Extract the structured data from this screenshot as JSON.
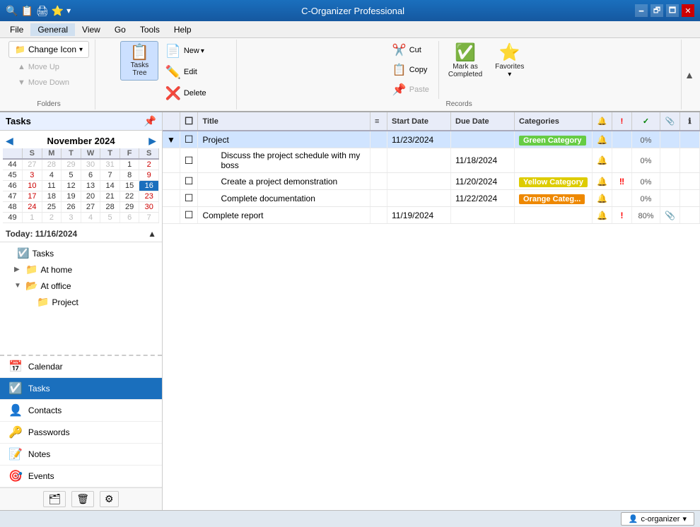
{
  "titlebar": {
    "title": "C-Organizer Professional",
    "controls": [
      "minimize",
      "restore",
      "maximize",
      "close"
    ]
  },
  "menu": {
    "items": [
      "File",
      "General",
      "View",
      "Go",
      "Tools",
      "Help"
    ],
    "active": "General"
  },
  "ribbon": {
    "folders_group": {
      "label": "Folders",
      "change_icon": "Change Icon",
      "move_up": "Move Up",
      "move_down": "Move Down",
      "change_icon_symbol": "📁"
    },
    "nav_group": {
      "tasks_tree_label": "Tasks\nTree",
      "new_label": "New",
      "edit_label": "Edit",
      "delete_label": "Delete",
      "tasks_tree_icon": "📋",
      "new_icon": "📄",
      "edit_icon": "✏️",
      "delete_icon": "❌"
    },
    "records_group": {
      "label": "Records",
      "cut_label": "Cut",
      "copy_label": "Copy",
      "paste_label": "Paste",
      "mark_completed_label": "Mark as\nCompleted",
      "favorites_label": "Favorites",
      "cut_icon": "✂️",
      "copy_icon": "📋",
      "paste_icon": "📌",
      "mark_icon": "✅",
      "favorites_icon": "⭐"
    }
  },
  "left_panel": {
    "tasks_header": "Tasks",
    "calendar": {
      "month": "November",
      "year": "2024",
      "month_year": "November 2024",
      "days_of_week": [
        "S",
        "M",
        "T",
        "W",
        "T",
        "F",
        "S"
      ],
      "week_nums": [
        "44",
        "45",
        "46",
        "47",
        "48",
        "49"
      ],
      "weeks": [
        [
          "27",
          "28",
          "29",
          "30",
          "31",
          "1",
          "2"
        ],
        [
          "3",
          "4",
          "5",
          "6",
          "7",
          "8",
          "9"
        ],
        [
          "10",
          "11",
          "12",
          "13",
          "14",
          "15",
          "16"
        ],
        [
          "17",
          "18",
          "19",
          "20",
          "21",
          "22",
          "23"
        ],
        [
          "24",
          "25",
          "26",
          "27",
          "28",
          "29",
          "30"
        ],
        [
          "1",
          "2",
          "3",
          "4",
          "5",
          "6",
          "7"
        ]
      ],
      "today_col": 6,
      "today_row": 2,
      "today_date": 16
    },
    "today_label": "Today: 11/16/2024",
    "tree": [
      {
        "label": "Tasks",
        "icon": "📋",
        "indent": 0,
        "has_expander": false,
        "expander": ""
      },
      {
        "label": "At home",
        "icon": "📁",
        "indent": 1,
        "has_expander": true,
        "expander": "▶"
      },
      {
        "label": "At office",
        "icon": "📂",
        "indent": 1,
        "has_expander": true,
        "expander": "▼"
      },
      {
        "label": "Project",
        "icon": "📁",
        "indent": 2,
        "has_expander": false,
        "expander": ""
      }
    ],
    "nav_items": [
      {
        "label": "Calendar",
        "icon": "📅",
        "id": "calendar"
      },
      {
        "label": "Tasks",
        "icon": "☑️",
        "id": "tasks",
        "active": true
      },
      {
        "label": "Contacts",
        "icon": "👤",
        "id": "contacts"
      },
      {
        "label": "Passwords",
        "icon": "🔑",
        "id": "passwords"
      },
      {
        "label": "Notes",
        "icon": "📝",
        "id": "notes"
      },
      {
        "label": "Events",
        "icon": "🎯",
        "id": "events"
      }
    ]
  },
  "task_table": {
    "columns": [
      {
        "label": "",
        "key": "expand"
      },
      {
        "label": "",
        "key": "check"
      },
      {
        "label": "Title",
        "key": "title"
      },
      {
        "label": "",
        "key": "filter"
      },
      {
        "label": "Start Date",
        "key": "start_date"
      },
      {
        "label": "Due Date",
        "key": "due_date"
      },
      {
        "label": "Categories",
        "key": "categories"
      },
      {
        "label": "🔔",
        "key": "alarm"
      },
      {
        "label": "!",
        "key": "priority"
      },
      {
        "label": "✓",
        "key": "complete"
      },
      {
        "label": "📎",
        "key": "attach"
      },
      {
        "label": "ℹ",
        "key": "info"
      }
    ],
    "rows": [
      {
        "id": "project",
        "title": "Project",
        "start_date": "11/23/2024",
        "due_date": "",
        "category": "Green Category",
        "category_class": "cat-green",
        "alarm": "🔔",
        "priority": "",
        "complete": "0%",
        "attach": "",
        "info": "",
        "indent": 0,
        "expandable": true,
        "expanded": true,
        "selected": true
      },
      {
        "id": "discuss",
        "title": "Discuss the project schedule with my boss",
        "start_date": "",
        "due_date": "11/18/2024",
        "category": "",
        "category_class": "",
        "alarm": "🔔",
        "priority": "",
        "complete": "0%",
        "attach": "",
        "info": "",
        "indent": 1,
        "expandable": false,
        "expanded": false,
        "selected": false
      },
      {
        "id": "demo",
        "title": "Create a project demonstration",
        "start_date": "",
        "due_date": "11/20/2024",
        "category": "Yellow Category",
        "category_class": "cat-yellow",
        "alarm": "🔔",
        "priority": "‼",
        "complete": "0%",
        "attach": "",
        "info": "",
        "indent": 1,
        "expandable": false,
        "expanded": false,
        "selected": false
      },
      {
        "id": "docs",
        "title": "Complete documentation",
        "start_date": "",
        "due_date": "11/22/2024",
        "category": "Orange Categ...",
        "category_class": "cat-orange",
        "alarm": "🔔",
        "priority": "",
        "complete": "0%",
        "attach": "",
        "info": "",
        "indent": 1,
        "expandable": false,
        "expanded": false,
        "selected": false
      },
      {
        "id": "report",
        "title": "Complete report",
        "start_date": "11/19/2024",
        "due_date": "",
        "category": "",
        "category_class": "",
        "alarm": "🔔",
        "priority": "!",
        "complete": "80%",
        "attach": "📎",
        "info": "",
        "indent": 0,
        "expandable": false,
        "expanded": false,
        "selected": false
      }
    ]
  },
  "status_bar": {
    "user": "c-organizer",
    "chevron": "▾"
  }
}
